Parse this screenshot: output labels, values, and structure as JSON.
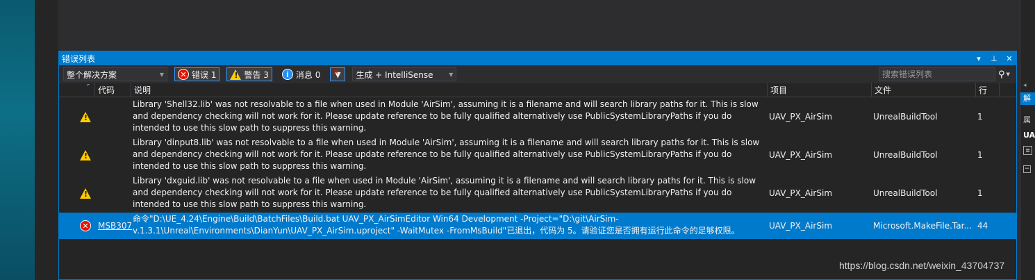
{
  "window": {
    "title": "错误列表",
    "title_icons": [
      "▾",
      "⊥",
      "✕"
    ]
  },
  "toolbar": {
    "scope": "整个解决方案",
    "errors_label": "错误 1",
    "warnings_label": "警告 3",
    "messages_label": "消息 0",
    "build_filter": "生成 + IntelliSense",
    "search_placeholder": "搜索错误列表"
  },
  "columns": {
    "code": "代码",
    "description": "说明",
    "project": "项目",
    "file": "文件",
    "line": "行"
  },
  "rows": [
    {
      "severity": "warning",
      "code": "",
      "description": "Library 'Shell32.lib' was not resolvable to a file when used in Module 'AirSim', assuming it is a filename and will search library paths for it. This is slow and dependency checking will not work for it. Please update reference to be fully qualified alternatively use PublicSystemLibraryPaths if you do intended to use this slow path to suppress this warning.",
      "project": "UAV_PX_AirSim",
      "file": "UnrealBuildTool",
      "line": "1"
    },
    {
      "severity": "warning",
      "code": "",
      "description": "Library 'dinput8.lib' was not resolvable to a file when used in Module 'AirSim', assuming it is a filename and will search library paths for it. This is slow and dependency checking will not work for it. Please update reference to be fully qualified alternatively use PublicSystemLibraryPaths if you do intended to use this slow path to suppress this warning.",
      "project": "UAV_PX_AirSim",
      "file": "UnrealBuildTool",
      "line": "1"
    },
    {
      "severity": "warning",
      "code": "",
      "description": "Library 'dxguid.lib' was not resolvable to a file when used in Module 'AirSim', assuming it is a filename and will search library paths for it. This is slow and dependency checking will not work for it. Please update reference to be fully qualified alternatively use PublicSystemLibraryPaths if you do intended to use this slow path to suppress this warning.",
      "project": "UAV_PX_AirSim",
      "file": "UnrealBuildTool",
      "line": "1"
    },
    {
      "severity": "error",
      "code": "MSB307",
      "description": "命令\"D:\\UE_4.24\\Engine\\Build\\BatchFiles\\Build.bat UAV_PX_AirSimEditor Win64 Development -Project=\"D:\\git\\AirSim-v.1.3.1\\Unreal\\Environments\\DianYun\\UAV_PX_AirSim.uproject\" -WaitMutex -FromMsBuild\"已退出，代码为 5。请验证您是否拥有运行此命令的足够权限。",
      "project": "UAV_PX_AirSim",
      "file": "Microsoft.MakeFile.Tar...",
      "line": "44"
    }
  ],
  "side_panel": {
    "tab_label": "解",
    "properties_label": "属",
    "object_label": "UA"
  },
  "watermark": "https://blog.csdn.net/weixin_43704737"
}
